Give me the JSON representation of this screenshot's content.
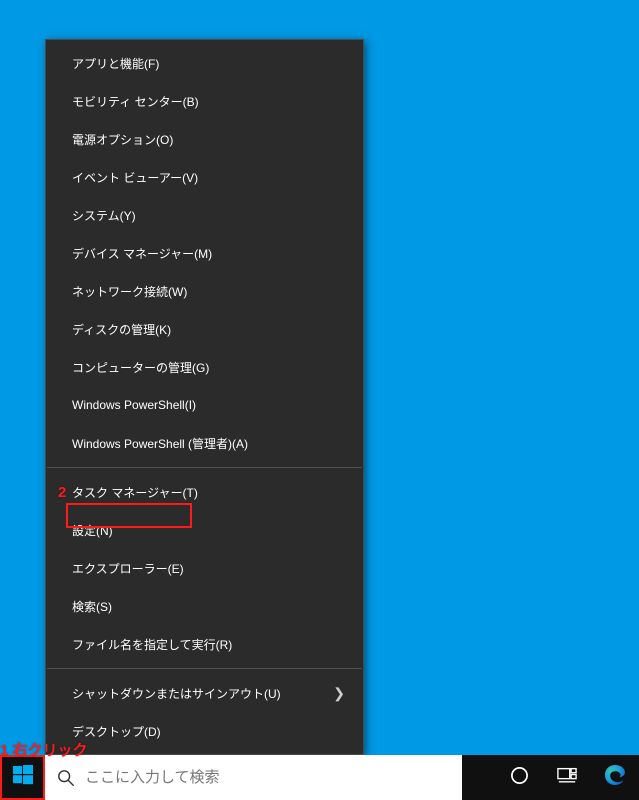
{
  "annotations": {
    "label1": "1 右クリック",
    "label2": "2"
  },
  "menu": {
    "groups": [
      [
        {
          "label": "アプリと機能(F)",
          "submenu": false
        },
        {
          "label": "モビリティ センター(B)",
          "submenu": false
        },
        {
          "label": "電源オプション(O)",
          "submenu": false
        },
        {
          "label": "イベント ビューアー(V)",
          "submenu": false
        },
        {
          "label": "システム(Y)",
          "submenu": false
        },
        {
          "label": "デバイス マネージャー(M)",
          "submenu": false
        },
        {
          "label": "ネットワーク接続(W)",
          "submenu": false
        },
        {
          "label": "ディスクの管理(K)",
          "submenu": false
        },
        {
          "label": "コンピューターの管理(G)",
          "submenu": false
        },
        {
          "label": "Windows PowerShell(I)",
          "submenu": false
        },
        {
          "label": "Windows PowerShell (管理者)(A)",
          "submenu": false
        }
      ],
      [
        {
          "label": "タスク マネージャー(T)",
          "submenu": false
        },
        {
          "label": "設定(N)",
          "submenu": false
        },
        {
          "label": "エクスプローラー(E)",
          "submenu": false
        },
        {
          "label": "検索(S)",
          "submenu": false
        },
        {
          "label": "ファイル名を指定して実行(R)",
          "submenu": false
        }
      ],
      [
        {
          "label": "シャットダウンまたはサインアウト(U)",
          "submenu": true
        },
        {
          "label": "デスクトップ(D)",
          "submenu": false
        }
      ]
    ]
  },
  "taskbar": {
    "search_placeholder": "ここに入力して検索",
    "start_icon": "windows-logo-icon",
    "search_icon": "search-icon",
    "cortana_icon": "cortana-icon",
    "taskview_icon": "task-view-icon",
    "edge_icon": "edge-icon"
  },
  "colors": {
    "desktop_bg": "#0099e5",
    "menu_bg": "#2b2b2b",
    "menu_text": "#ffffff",
    "taskbar_bg": "#101010",
    "highlight": "#ff1a1a",
    "start_logo": "#00adef"
  }
}
